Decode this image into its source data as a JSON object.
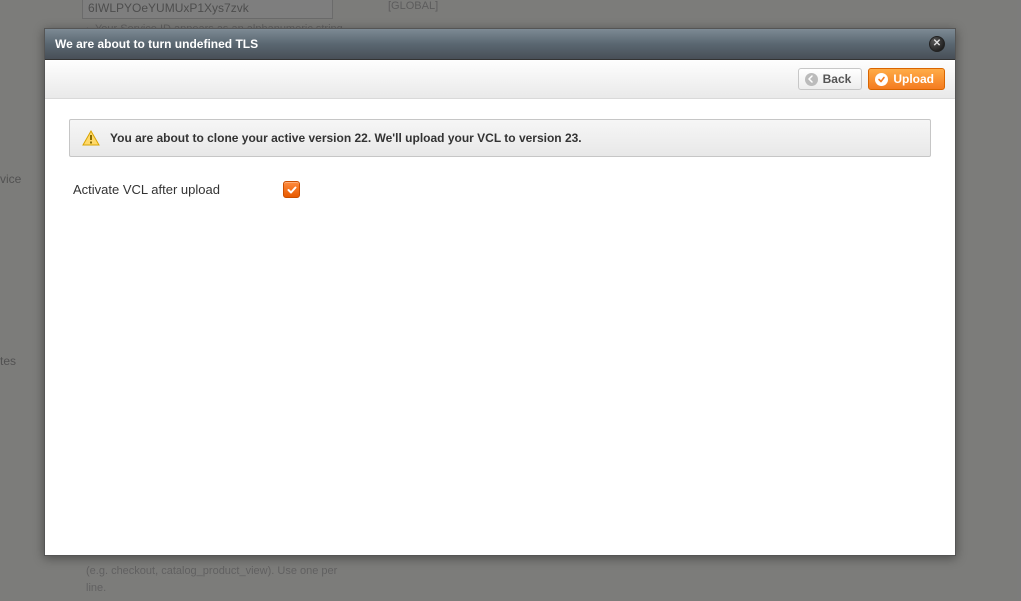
{
  "background": {
    "service_id_value": "6IWLPYOeYUMUxP1Xys7zvk",
    "service_id_hint": "Your Service ID appears as an alphanumeric string",
    "scope_label": "[GLOBAL]",
    "left_label_1": "vice",
    "left_label_2": "tes",
    "bottom_hint_line1": "(e.g. checkout, catalog_product_view). Use one per",
    "bottom_hint_line2": "line."
  },
  "modal": {
    "title": "We are about to turn undefined TLS",
    "back_label": "Back",
    "upload_label": "Upload",
    "notice_text": "You are about to clone your active version 22. We'll upload your VCL to version 23.",
    "activate_label": "Activate VCL after upload",
    "activate_checked": true
  }
}
